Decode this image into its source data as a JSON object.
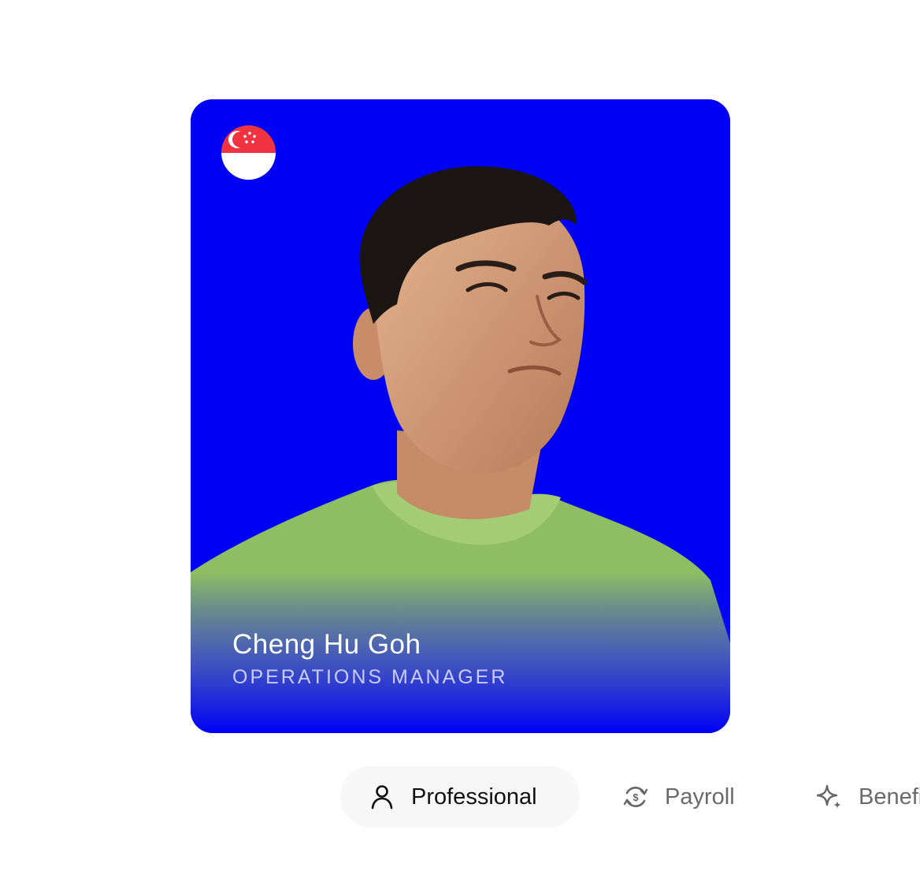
{
  "profile": {
    "name": "Cheng Hu Goh",
    "role": "OPERATIONS MANAGER",
    "background_color": "#0000f5",
    "flag": "singapore-flag-icon"
  },
  "tabs": [
    {
      "label": "Professional",
      "icon": "person-icon",
      "active": true
    },
    {
      "label": "Payroll",
      "icon": "payroll-cycle-icon",
      "active": false
    },
    {
      "label": "Benefits",
      "icon": "sparkle-icon",
      "active": false
    }
  ]
}
